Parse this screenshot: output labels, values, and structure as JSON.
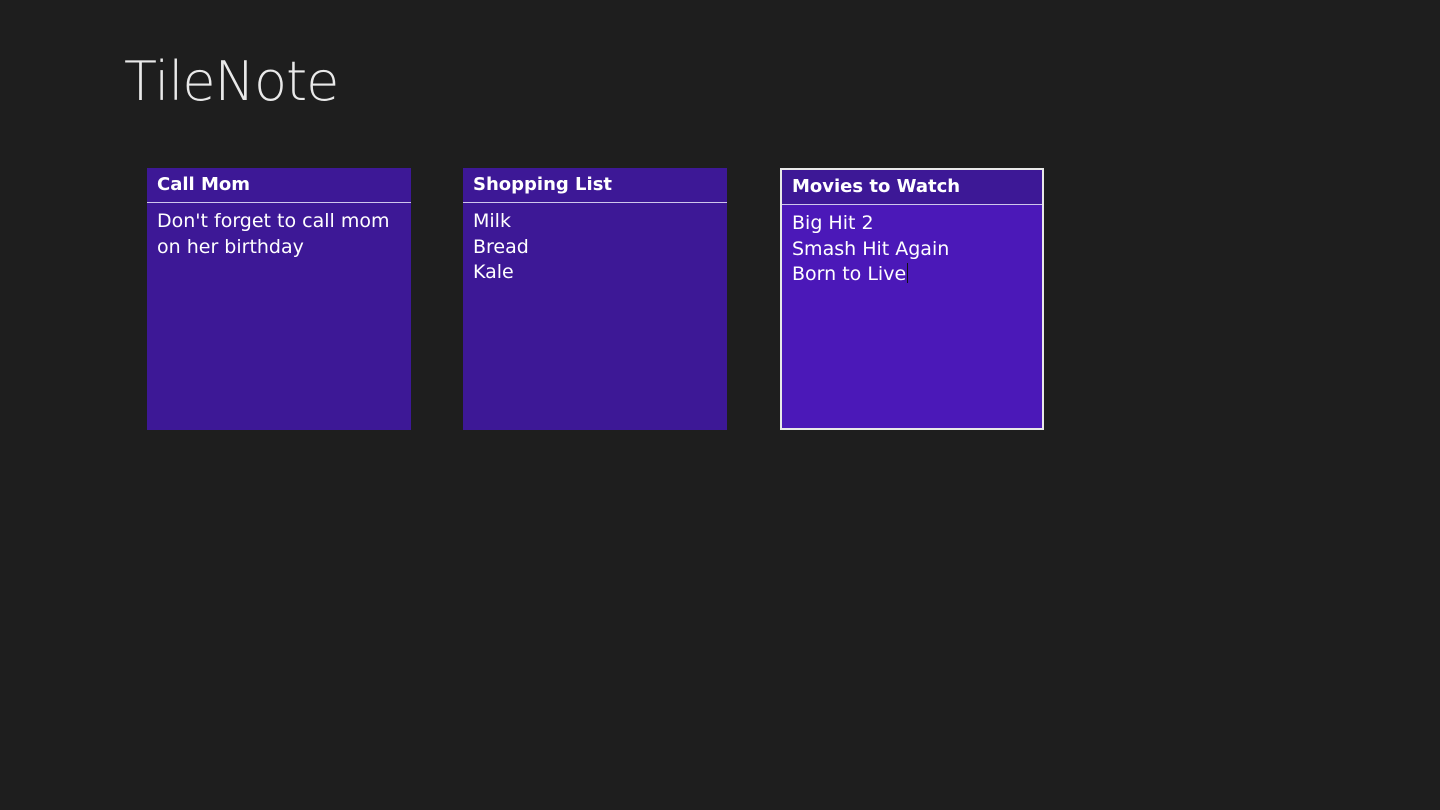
{
  "app": {
    "title": "TileNote"
  },
  "notes": [
    {
      "title": "Call Mom",
      "body": "Don't forget to call mom on her birthday"
    },
    {
      "title": "Shopping List",
      "lines": [
        "Milk",
        "Bread",
        "Kale"
      ]
    },
    {
      "title": "Movies to Watch",
      "lines": [
        "Big Hit 2",
        "Smash Hit Again",
        "Born to Live"
      ],
      "selected": true
    }
  ],
  "colors": {
    "background": "#1e1e1e",
    "tile": "#3d1896",
    "tile_selected": "#4b18b8",
    "text": "#ffffff"
  }
}
